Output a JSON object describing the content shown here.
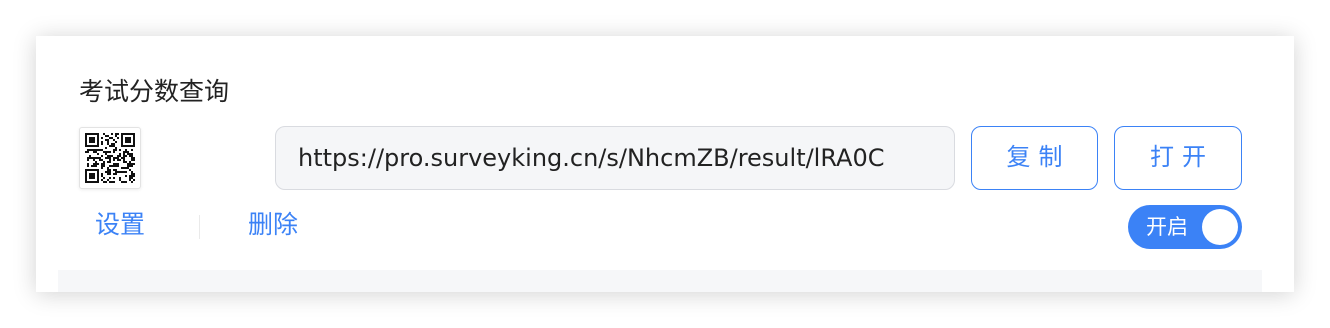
{
  "card": {
    "title": "考试分数查询",
    "url": "https://pro.surveyking.cn/s/NhcmZB/result/lRA0C",
    "buttons": {
      "copy_label": "复制",
      "open_label": "打开"
    },
    "actions": {
      "settings_label": "设置",
      "delete_label": "删除"
    },
    "toggle": {
      "label": "开启",
      "state": "on"
    },
    "qr_icon": "qr-code-icon"
  },
  "colors": {
    "accent": "#3b82f6",
    "input_bg": "#f5f6f8",
    "input_border": "#d9dbe0",
    "title_text": "#222222"
  }
}
